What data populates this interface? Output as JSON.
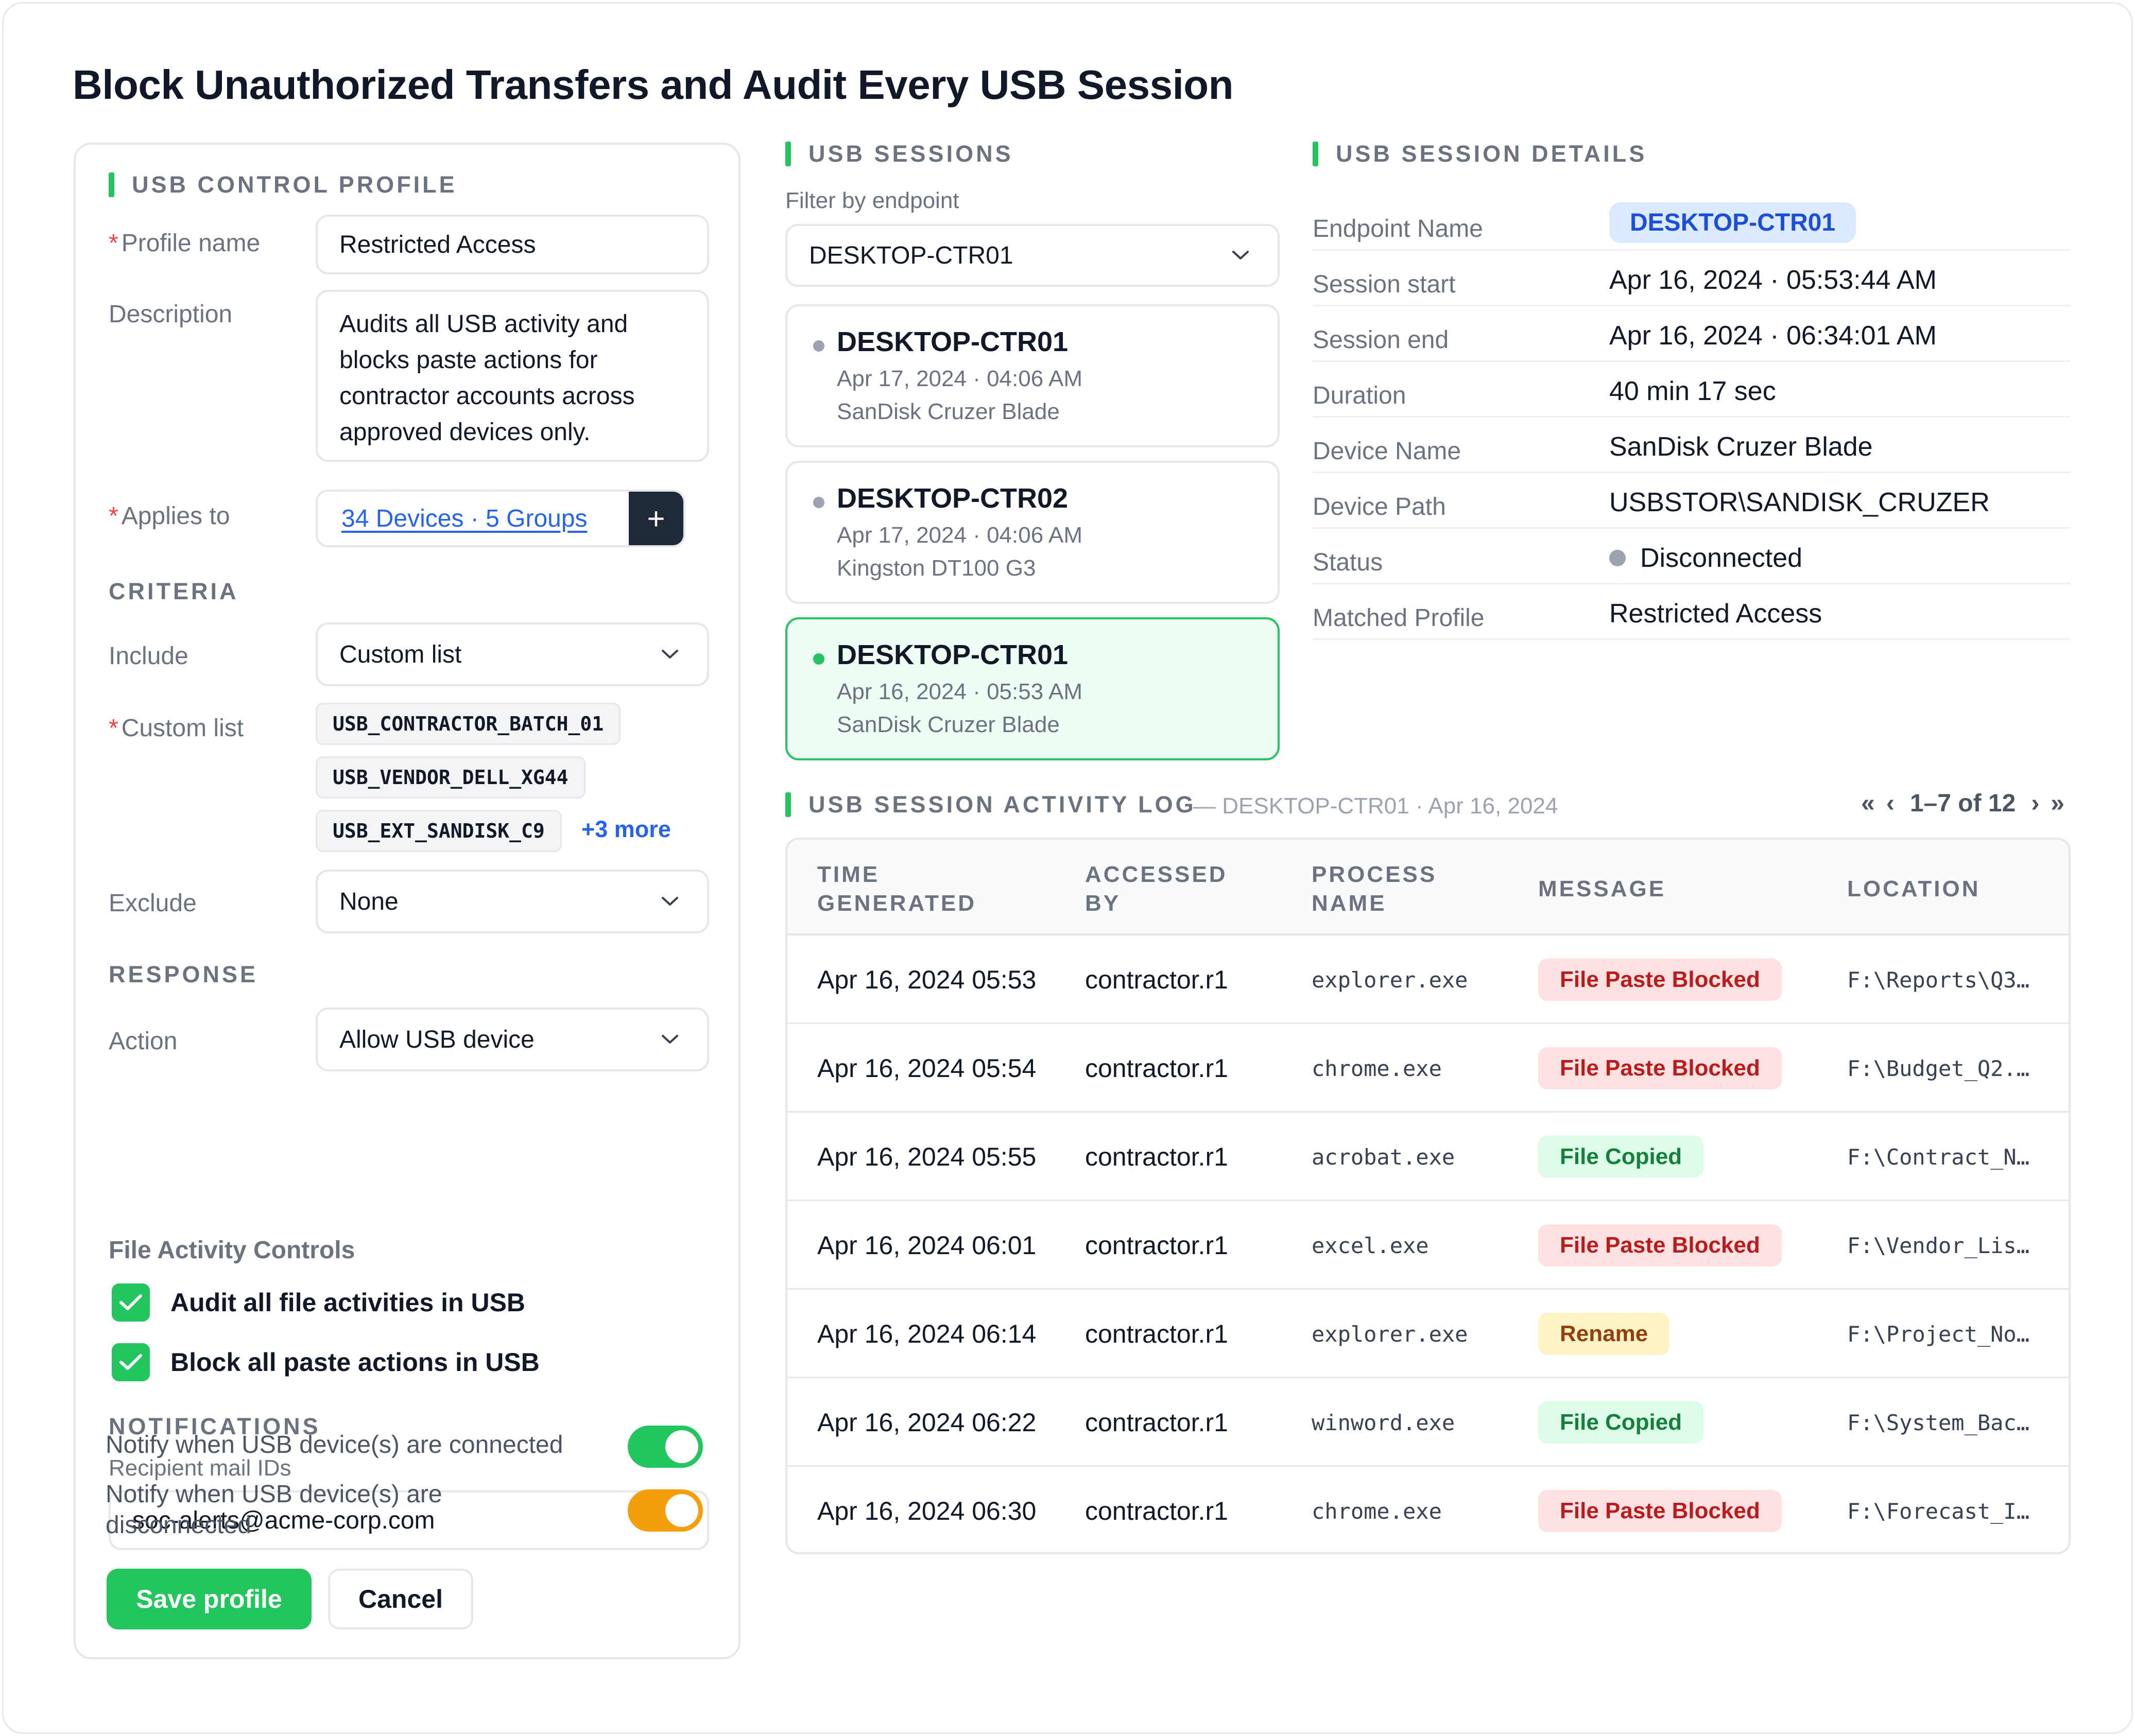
{
  "page": {
    "title": "Block Unauthorized Transfers and Audit Every USB Session"
  },
  "profile": {
    "section_title": "USB CONTROL PROFILE",
    "profile_name_label": "Profile name",
    "profile_name_value": "Restricted Access",
    "description_label": "Description",
    "description_value": "Audits all USB activity and blocks paste actions for contractor accounts across approved devices only.",
    "applies_to_label": "Applies to",
    "applies_to_value": "34 Devices · 5 Groups",
    "applies_to_add": "+",
    "criteria_title": "CRITERIA",
    "include_label": "Include",
    "include_value": "Custom list",
    "custom_list_label": "Custom list",
    "custom_list_items": [
      "USB_CONTRACTOR_BATCH_01",
      "USB_VENDOR_DELL_XG44",
      "USB_EXT_SANDISK_C9"
    ],
    "custom_list_more": "+3 more",
    "exclude_label": "Exclude",
    "exclude_value": "None",
    "response_title": "RESPONSE",
    "action_label": "Action",
    "action_value": "Allow USB device",
    "file_controls_title": "File Activity Controls",
    "checkboxes": [
      {
        "label": "Audit all file activities in USB",
        "checked": true
      },
      {
        "label": "Block all paste actions in USB",
        "checked": true
      }
    ],
    "notifications_title": "NOTIFICATIONS",
    "recipient_label": "Recipient mail IDs",
    "recipient_value": "soc-alerts@acme-corp.com",
    "notify_connected_label": "Notify when USB device(s) are connected",
    "notify_connected_on": true,
    "notify_disconnected_label": "Notify when USB device(s) are disconnected",
    "notify_disconnected_on": true,
    "save_label": "Save profile",
    "cancel_label": "Cancel"
  },
  "sessions": {
    "section_title": "USB SESSIONS",
    "filter_label": "Filter by endpoint",
    "filter_value": "DESKTOP-CTR01",
    "items": [
      {
        "endpoint": "DESKTOP-CTR01",
        "time": "Apr 17, 2024 · 04:06 AM",
        "device": "SanDisk Cruzer Blade",
        "selected": false
      },
      {
        "endpoint": "DESKTOP-CTR02",
        "time": "Apr 17, 2024 · 04:06 AM",
        "device": "Kingston DT100 G3",
        "selected": false
      },
      {
        "endpoint": "DESKTOP-CTR01",
        "time": "Apr 16, 2024 · 05:53 AM",
        "device": "SanDisk Cruzer Blade",
        "selected": true
      }
    ]
  },
  "details": {
    "section_title": "USB SESSION DETAILS",
    "rows": [
      {
        "label": "Endpoint Name",
        "value": "DESKTOP-CTR01"
      },
      {
        "label": "Session start",
        "value": "Apr 16, 2024 · 05:53:44 AM"
      },
      {
        "label": "Session end",
        "value": "Apr 16, 2024 · 06:34:01 AM"
      },
      {
        "label": "Duration",
        "value": "40 min 17 sec"
      },
      {
        "label": "Device Name",
        "value": "SanDisk Cruzer Blade"
      },
      {
        "label": "Device Path",
        "value": "USBSTOR\\SANDISK_CRUZER"
      },
      {
        "label": "Status",
        "value": "Disconnected"
      },
      {
        "label": "Matched Profile",
        "value": "Restricted Access"
      }
    ]
  },
  "log": {
    "section_title": "USB SESSION ACTIVITY LOG",
    "subtitle": "— DESKTOP-CTR01 · Apr 16, 2024",
    "pager": {
      "first": "«",
      "prev": "‹",
      "range": "1–7 of 12",
      "next": "›",
      "last": "»"
    },
    "columns": [
      "TIME GENERATED",
      "ACCESSED BY",
      "PROCESS NAME",
      "MESSAGE",
      "LOCATION"
    ],
    "rows": [
      {
        "time": "Apr 16, 2024 05:53",
        "user": "contractor.r1",
        "process": "explorer.exe",
        "message": "File Paste Blocked",
        "kind": "blocked",
        "location": "F:\\Reports\\Q3…"
      },
      {
        "time": "Apr 16, 2024 05:54",
        "user": "contractor.r1",
        "process": "chrome.exe",
        "message": "File Paste Blocked",
        "kind": "blocked",
        "location": "F:\\Budget_Q2.…"
      },
      {
        "time": "Apr 16, 2024 05:55",
        "user": "contractor.r1",
        "process": "acrobat.exe",
        "message": "File Copied",
        "kind": "copied",
        "location": "F:\\Contract_N…"
      },
      {
        "time": "Apr 16, 2024 06:01",
        "user": "contractor.r1",
        "process": "excel.exe",
        "message": "File Paste Blocked",
        "kind": "blocked",
        "location": "F:\\Vendor_Lis…"
      },
      {
        "time": "Apr 16, 2024 06:14",
        "user": "contractor.r1",
        "process": "explorer.exe",
        "message": "Rename",
        "kind": "rename",
        "location": "F:\\Project_No…"
      },
      {
        "time": "Apr 16, 2024 06:22",
        "user": "contractor.r1",
        "process": "winword.exe",
        "message": "File Copied",
        "kind": "copied",
        "location": "F:\\System_Bac…"
      },
      {
        "time": "Apr 16, 2024 06:30",
        "user": "contractor.r1",
        "process": "chrome.exe",
        "message": "File Paste Blocked",
        "kind": "blocked",
        "location": "F:\\Forecast_I…"
      }
    ]
  },
  "colors": {
    "accent": "#22c55e",
    "toggle_connected": "#22c55e",
    "toggle_disconnected": "#f59e0b",
    "link": "#2563eb",
    "badge_blocked_bg": "#fee2e2",
    "badge_blocked_fg": "#b91c1c",
    "badge_copied_bg": "#dcfce7",
    "badge_copied_fg": "#15803d",
    "badge_rename_bg": "#fef3c7",
    "badge_rename_fg": "#92400e",
    "session_dot_idle": "#9ca3af",
    "session_dot_active": "#22c55e"
  },
  "icons": {
    "select": "chevron-down-icon",
    "checkbox": "check-icon",
    "add": "plus-icon"
  }
}
